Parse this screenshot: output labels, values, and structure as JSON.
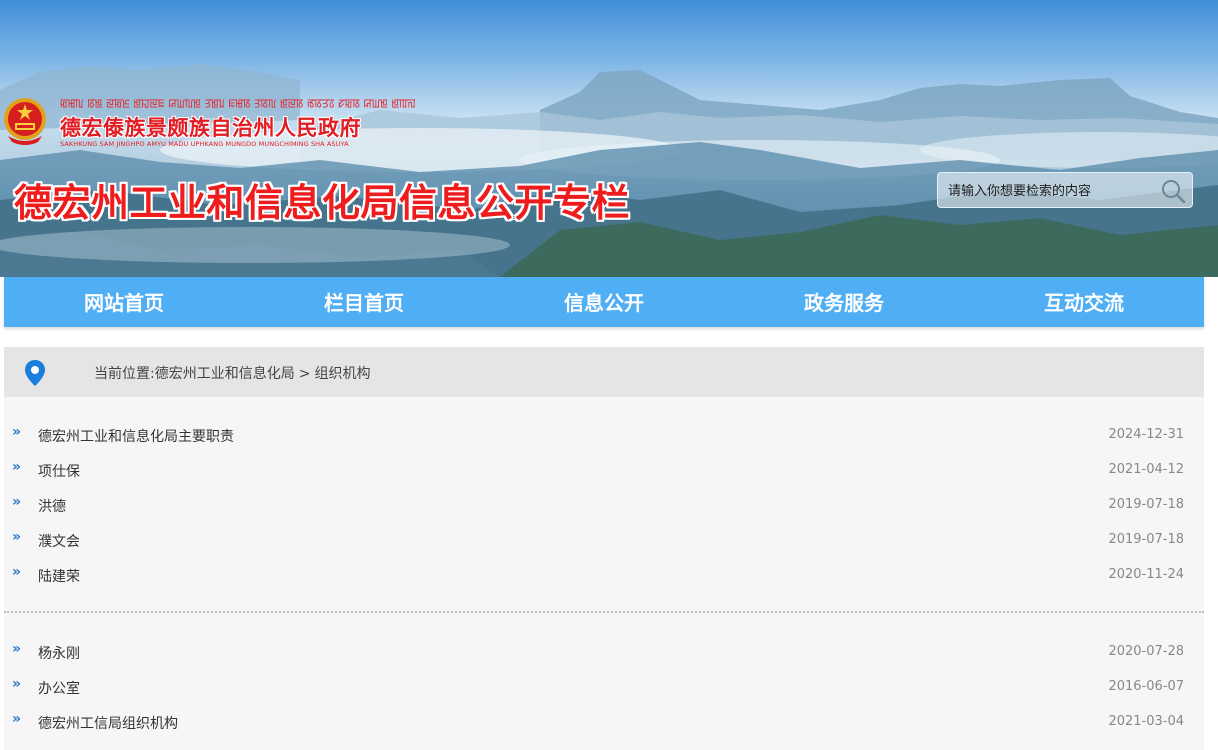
{
  "header": {
    "tibetan_line": "ꡂꡅꡃ ꡋꡁ ꡙꡂꡈ ꡁꡍꡙꡀ ꡒꡆꡃꡁ ꡗꡁꡊ ꡀꡅꡋ ꡗꡋꡃ ꡁꡙꡋ ꡏꡋꡗꡞ ꡛꡂꡋ ꡒꡆꡁ ꡁꡄꡌ",
    "gov_name": "德宏傣族景颇族自治州人民政府",
    "gov_name_en": "SAKHKUNG SAM JINGHPO AMYU MADU UPHKANG MUNGDO MUNGCHIMING SHA ASUYA",
    "column_title": "德宏州工业和信息化局信息公开专栏",
    "search_placeholder": "请输入你想要检索的内容",
    "emblem_icon": "national-emblem-icon",
    "search_icon": "search-icon"
  },
  "nav": {
    "items": [
      {
        "label": "网站首页"
      },
      {
        "label": "栏目首页"
      },
      {
        "label": "信息公开"
      },
      {
        "label": "政务服务"
      },
      {
        "label": "互动交流"
      }
    ]
  },
  "breadcrumb": {
    "prefix": "当前位置:",
    "link1": "德宏州工业和信息化局",
    "sep": ">",
    "link2": "组织机构",
    "icon": "location-pin-icon"
  },
  "lists": {
    "group1": [
      {
        "title": "德宏州工业和信息化局主要职责",
        "date": "2024-12-31"
      },
      {
        "title": "项仕保",
        "date": "2021-04-12"
      },
      {
        "title": "洪德",
        "date": "2019-07-18"
      },
      {
        "title": "濮文会",
        "date": "2019-07-18"
      },
      {
        "title": "陆建荣",
        "date": "2020-11-24"
      }
    ],
    "group2": [
      {
        "title": "杨永刚",
        "date": "2020-07-28"
      },
      {
        "title": "办公室",
        "date": "2016-06-07"
      },
      {
        "title": "德宏州工信局组织机构",
        "date": "2021-03-04"
      }
    ]
  },
  "colors": {
    "nav_bg": "#50aef4",
    "title_red": "#ee1c1c",
    "arrow_blue": "#2979c9",
    "pin_blue": "#1a7fdc"
  }
}
